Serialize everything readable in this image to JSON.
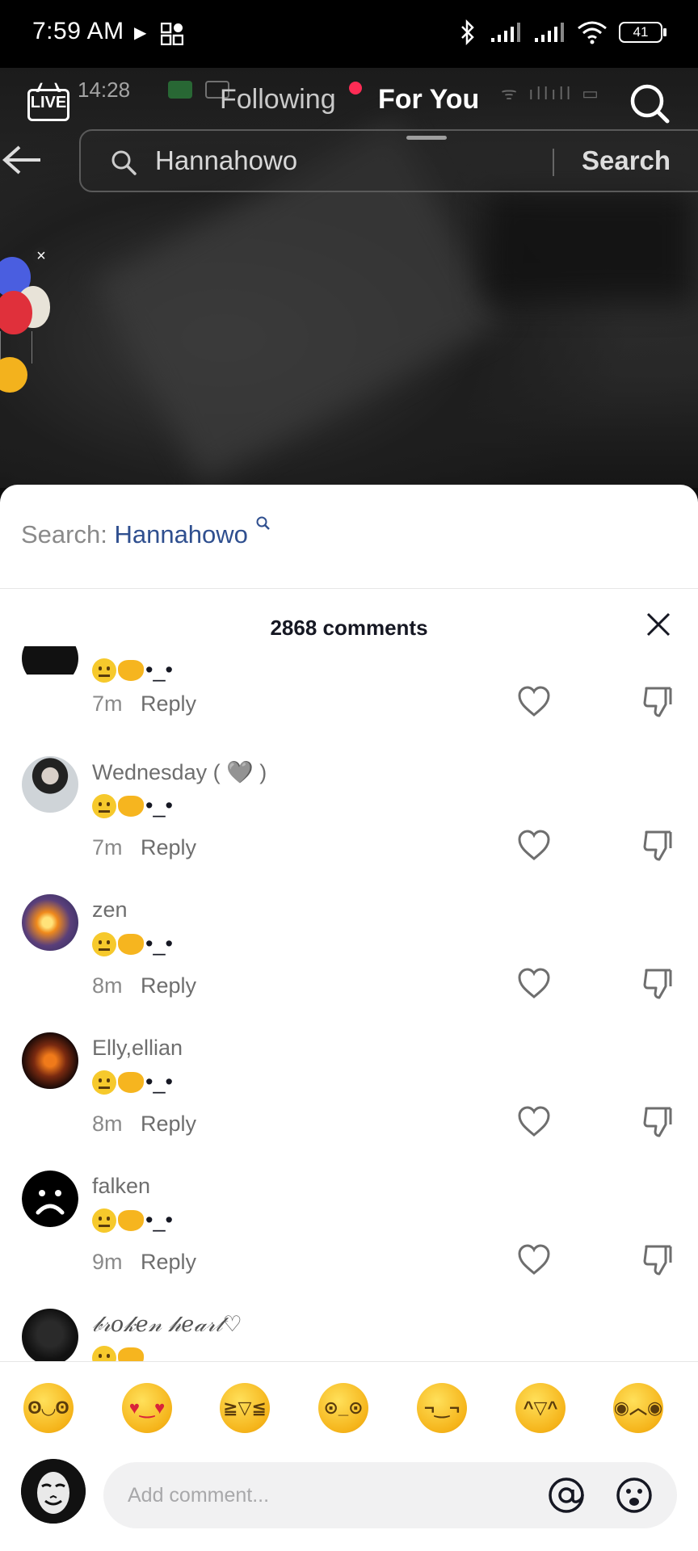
{
  "status_bar": {
    "time": "7:59 AM",
    "battery": "41"
  },
  "video_overlay": {
    "time": "14:28"
  },
  "top_nav": {
    "live_label": "LIVE",
    "tab_following": "Following",
    "tab_for_you": "For You",
    "icons": [
      "live-tv-icon",
      "search-icon"
    ]
  },
  "search_bar": {
    "query": "Hannahowo",
    "button_label": "Search",
    "icons": [
      "back-arrow-icon",
      "magnifier-icon"
    ]
  },
  "comments_panel": {
    "search_prefix": "Search: ",
    "search_term": "Hannahowo",
    "count_label": "2868 comments",
    "comment_text": "•_•",
    "reply_label": "Reply",
    "comments": [
      {
        "user": "",
        "time": "7m"
      },
      {
        "user": "Wednesday ( 🩶 )",
        "time": "7m"
      },
      {
        "user": "zen",
        "time": "8m"
      },
      {
        "user": "Elly,ellian",
        "time": "8m"
      },
      {
        "user": "falken",
        "time": "9m"
      },
      {
        "user": "𝒷𝓇𝑜𝓀𝑒𝓃 𝒽𝑒𝒶𝓇𝓉♡",
        "time": ""
      }
    ]
  },
  "emoji_bar": [
    "grin-emoji",
    "smiling-hearts-emoji",
    "tears-of-joy-emoji",
    "flushed-emoji",
    "smirk-emoji",
    "sweat-smile-emoji",
    "pleading-emoji"
  ],
  "composer": {
    "placeholder": "Add comment...",
    "icons": [
      "at-icon",
      "emoji-icon"
    ]
  },
  "colors": {
    "accent_red": "#fe2c55",
    "search_term": "#2f4f8f"
  }
}
